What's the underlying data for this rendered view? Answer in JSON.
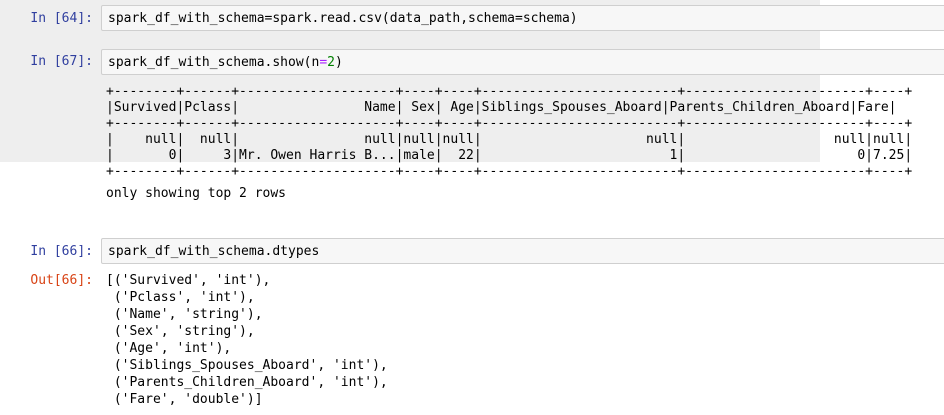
{
  "cells": [
    {
      "prompt": "In [64]:",
      "code": "spark_df_with_schema=spark.read.csv(data_path,schema=schema)"
    },
    {
      "prompt": "In [67]:",
      "code_pre": "spark_df_with_schema.show(n",
      "code_eq": "=",
      "code_num": "2",
      "code_post": ")",
      "table_lines": [
        "+--------+------+--------------------+----+----+-------------------------+-----------------------+----+",
        "|Survived|Pclass|                Name| Sex| Age|Siblings_Spouses_Aboard|Parents_Children_Aboard|Fare|",
        "+--------+------+--------------------+----+----+-------------------------+-----------------------+----+",
        "|    null|  null|                null|null|null|                     null|                   null|null|",
        "|       0|     3|Mr. Owen Harris B...|male|  22|                        1|                      0|7.25|",
        "+--------+------+--------------------+----+----+-------------------------+-----------------------+----+"
      ],
      "note": "only showing top 2 rows"
    },
    {
      "prompt": "In [66]:",
      "code": "spark_df_with_schema.dtypes",
      "out_prompt": "Out[66]:",
      "out_lines": [
        "[('Survived', 'int'),",
        " ('Pclass', 'int'),",
        " ('Name', 'string'),",
        " ('Sex', 'string'),",
        " ('Age', 'int'),",
        " ('Siblings_Spouses_Aboard', 'int'),",
        " ('Parents_Children_Aboard', 'int'),",
        " ('Fare', 'double')]"
      ]
    }
  ]
}
